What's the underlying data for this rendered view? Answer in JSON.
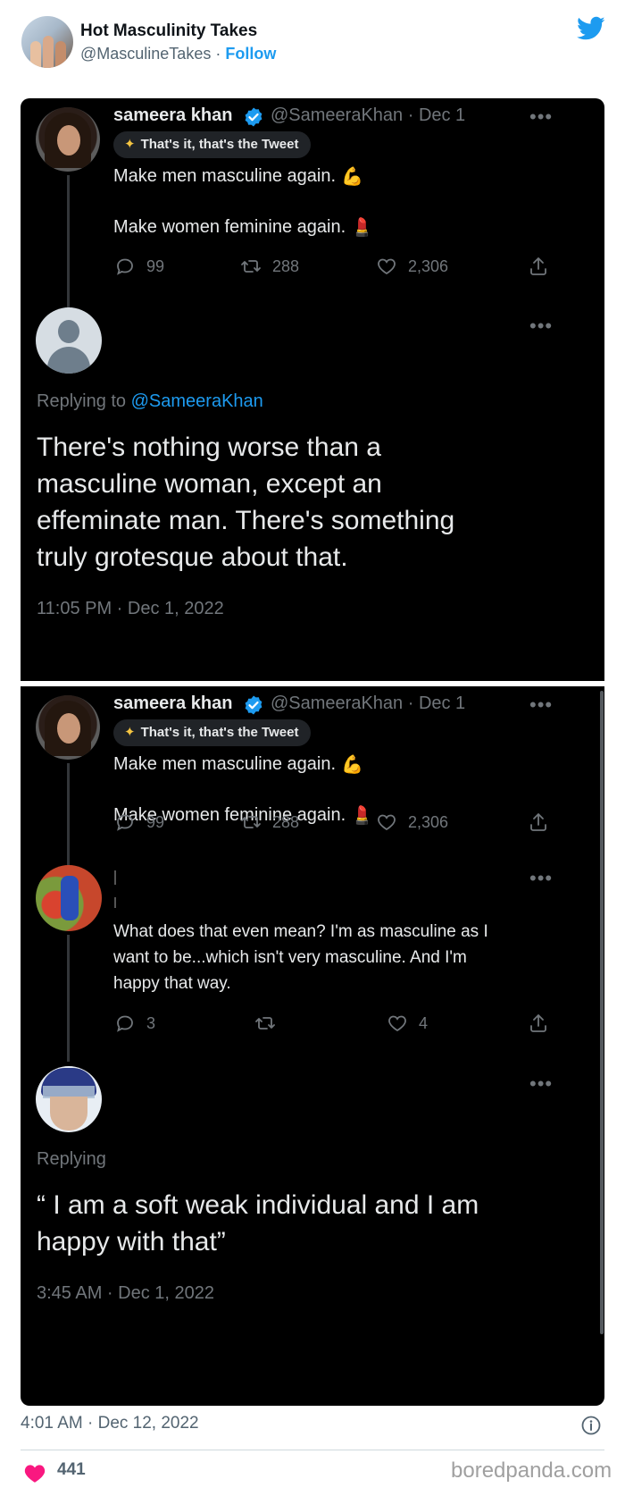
{
  "embed": {
    "author_name": "Hot Masculinity Takes",
    "author_handle": "@MasculineTakes",
    "separator": "·",
    "follow_label": "Follow",
    "timestamp": "4:01 AM · Dec 12, 2022",
    "likes": "441",
    "watermark": "boredpanda.com"
  },
  "shot1": {
    "original": {
      "name": "sameera khan",
      "handle_date": "@SameeraKhan · Dec 1",
      "pill": "That's it, that's the Tweet",
      "line1": "Make men masculine again.",
      "line1_emoji": "💪",
      "line2": "Make women feminine again.",
      "line2_emoji": "💄",
      "replies": "99",
      "retweets": "288",
      "likes": "2,306"
    },
    "reply": {
      "replying_prefix": "Replying to",
      "replying_to": "@SameeraKhan",
      "line1": "There's nothing worse than a",
      "line2": "masculine woman, except an",
      "line3": "effeminate man. There's something",
      "line4": "truly grotesque about that.",
      "timestamp": "11:05 PM · Dec 1, 2022"
    }
  },
  "shot2": {
    "original": {
      "name": "sameera khan",
      "handle_date": "@SameeraKhan · Dec 1",
      "pill": "That's it, that's the Tweet",
      "line1": "Make men masculine again.",
      "line1_emoji": "💪",
      "line2": "Make women feminine again.",
      "line2_emoji": "💄",
      "replies": "99",
      "retweets": "288",
      "likes": "2,306"
    },
    "middle": {
      "line1": "What does that even mean? I'm as masculine as I",
      "line2": "want to be...which isn't very masculine. And I'm",
      "line3": "happy that way.",
      "replies": "3",
      "likes": "4"
    },
    "final": {
      "replying_prefix": "Replying",
      "line1": "“ I am a soft weak individual and I am",
      "line2": "happy with that”",
      "timestamp": "3:45 AM · Dec 1, 2022"
    }
  },
  "colors": {
    "accent": "#1d9bf0",
    "dark_bg": "#000000",
    "muted": "#71767b",
    "like_pink": "#f91880"
  },
  "icons": [
    "twitter-bird-icon",
    "verified-badge-icon",
    "sparkles-icon",
    "reply-icon",
    "retweet-icon",
    "like-icon",
    "share-icon",
    "more-icon",
    "info-icon",
    "heart-icon"
  ]
}
